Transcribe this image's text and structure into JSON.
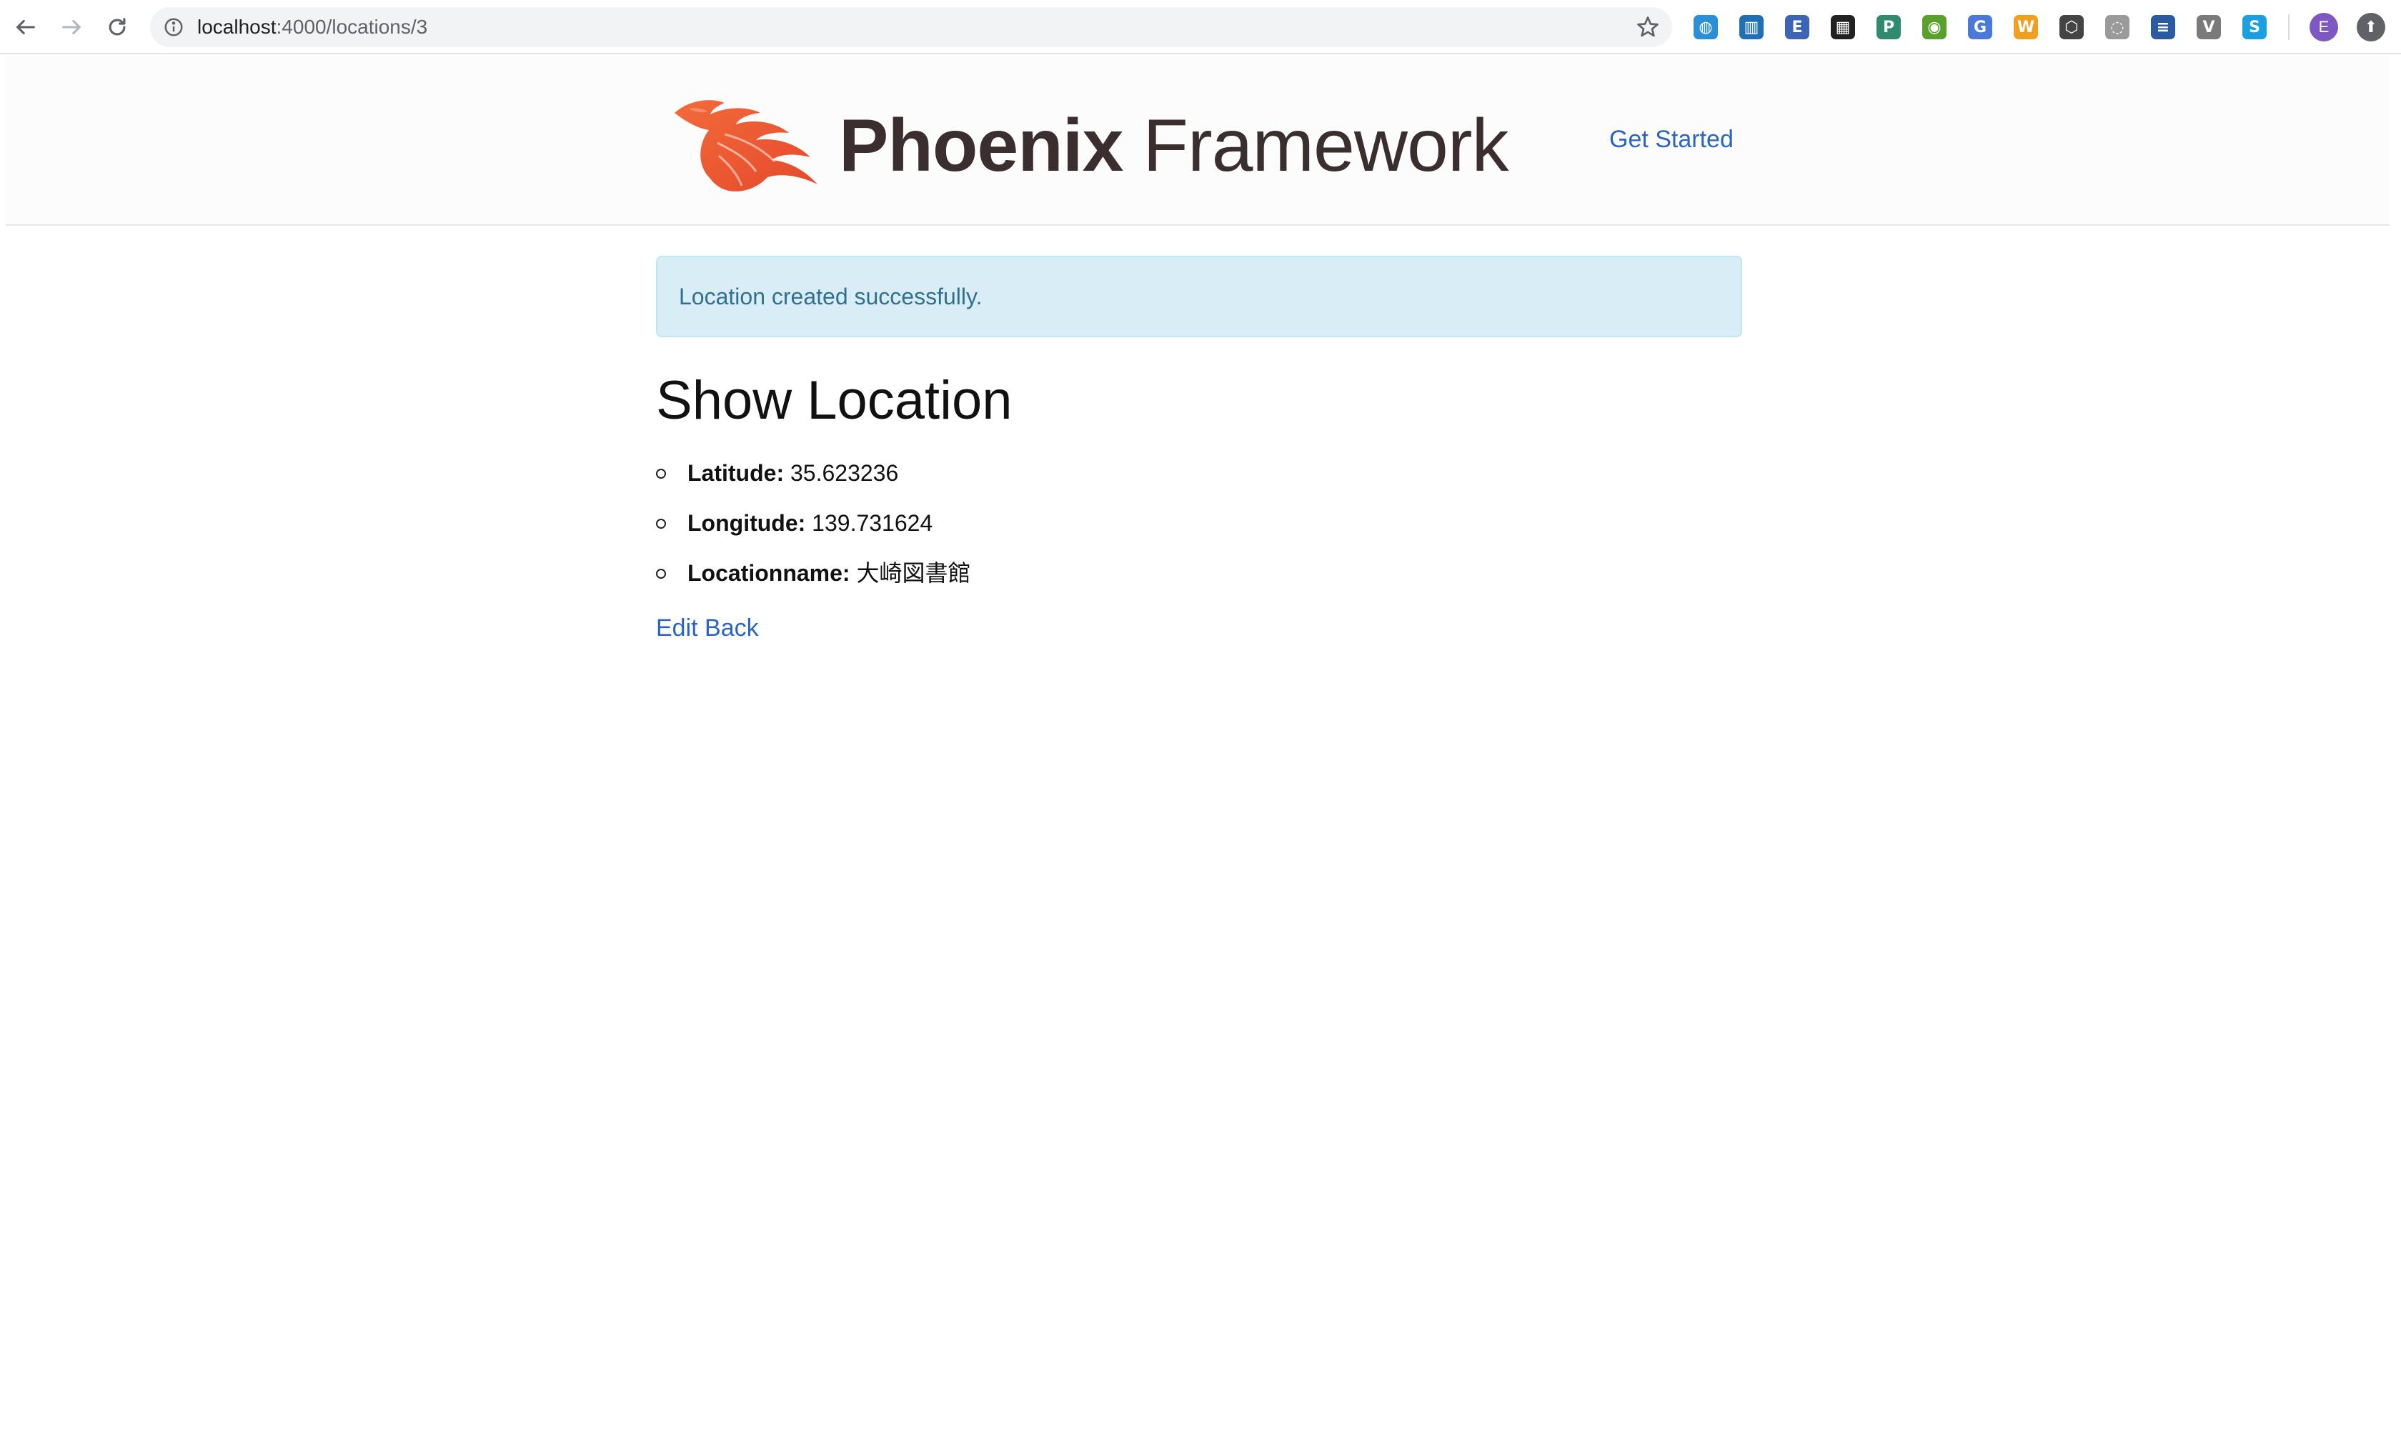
{
  "browser": {
    "url_host": "localhost",
    "url_path": ":4000/locations/3",
    "extensions": [
      {
        "icon": "globe-extension-icon",
        "glyph": "◍",
        "color": "#2a8fd6"
      },
      {
        "icon": "trello-extension-icon",
        "glyph": "▥",
        "color": "#1f6fb5"
      },
      {
        "icon": "pocket-extension-icon",
        "glyph": "E",
        "color": "#3c66b5"
      },
      {
        "icon": "qr-code-extension-icon",
        "glyph": "▦",
        "color": "#222222"
      },
      {
        "icon": "parking-extension-icon",
        "glyph": "P",
        "color": "#2f8a6e"
      },
      {
        "icon": "green-circle-extension-icon",
        "glyph": "◉",
        "color": "#5aa02c"
      },
      {
        "icon": "translate-extension-icon",
        "glyph": "G",
        "color": "#4a79d9"
      },
      {
        "icon": "w-extension-icon",
        "glyph": "W",
        "color": "#f0a020"
      },
      {
        "icon": "gear-extension-icon",
        "glyph": "⬡",
        "color": "#444444"
      },
      {
        "icon": "ghost-extension-icon",
        "glyph": "◌",
        "color": "#9a9a9a"
      },
      {
        "icon": "layers-extension-icon",
        "glyph": "≡",
        "color": "#2a5aa0"
      },
      {
        "icon": "v-extension-icon",
        "glyph": "V",
        "color": "#7a7a7a"
      },
      {
        "icon": "skype-extension-icon",
        "glyph": "S",
        "color": "#1aa0e0"
      }
    ],
    "profile_initial": "E"
  },
  "header": {
    "logo_bold": "Phoenix",
    "logo_light": " Framework",
    "get_started_label": "Get Started"
  },
  "flash": {
    "message": "Location created successfully."
  },
  "page": {
    "title": "Show Location",
    "fields": [
      {
        "label": "Latitude:",
        "value": "35.623236"
      },
      {
        "label": "Longitude:",
        "value": "139.731624"
      },
      {
        "label": "Locationname:",
        "value": "大崎図書館"
      }
    ],
    "edit_label": "Edit",
    "back_label": "Back"
  }
}
